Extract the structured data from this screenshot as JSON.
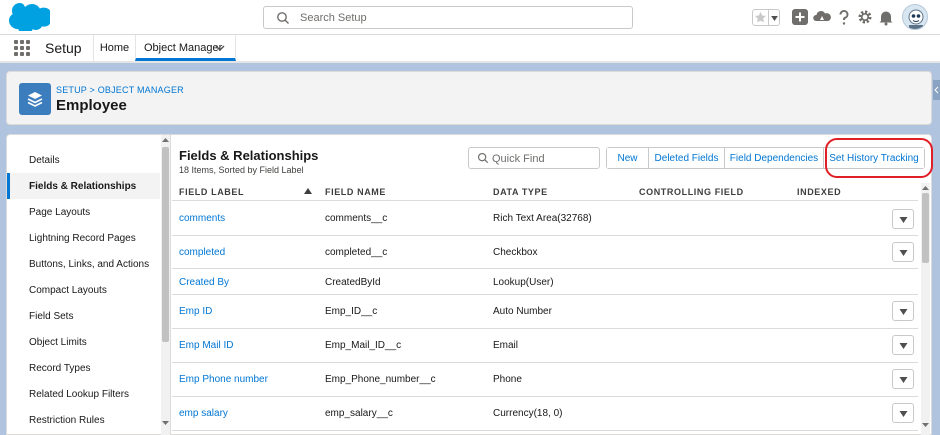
{
  "header": {
    "search_placeholder": "Search Setup"
  },
  "nav": {
    "app_name": "Setup",
    "tabs": [
      {
        "label": "Home"
      },
      {
        "label": "Object Manager"
      }
    ]
  },
  "object": {
    "breadcrumb": "SETUP > OBJECT MANAGER",
    "title": "Employee"
  },
  "sidebar": {
    "items": [
      {
        "label": "Details"
      },
      {
        "label": "Fields & Relationships"
      },
      {
        "label": "Page Layouts"
      },
      {
        "label": "Lightning Record Pages"
      },
      {
        "label": "Buttons, Links, and Actions"
      },
      {
        "label": "Compact Layouts"
      },
      {
        "label": "Field Sets"
      },
      {
        "label": "Object Limits"
      },
      {
        "label": "Record Types"
      },
      {
        "label": "Related Lookup Filters"
      },
      {
        "label": "Restriction Rules"
      }
    ]
  },
  "section": {
    "title": "Fields & Relationships",
    "subtitle": "18 Items, Sorted by Field Label",
    "quick_find_placeholder": "Quick Find",
    "buttons": [
      {
        "label": "New"
      },
      {
        "label": "Deleted Fields"
      },
      {
        "label": "Field Dependencies"
      },
      {
        "label": "Set History Tracking"
      }
    ]
  },
  "table": {
    "columns": [
      "FIELD LABEL",
      "FIELD NAME",
      "DATA TYPE",
      "CONTROLLING FIELD",
      "INDEXED"
    ],
    "rows": [
      {
        "label": "comments",
        "name": "comments__c",
        "type": "Rich Text Area(32768)",
        "controlling": "",
        "indexed": "",
        "has_menu": true
      },
      {
        "label": "completed",
        "name": "completed__c",
        "type": "Checkbox",
        "controlling": "",
        "indexed": "",
        "has_menu": true
      },
      {
        "label": "Created By",
        "name": "CreatedById",
        "type": "Lookup(User)",
        "controlling": "",
        "indexed": "",
        "has_menu": false
      },
      {
        "label": "Emp ID",
        "name": "Emp_ID__c",
        "type": "Auto Number",
        "controlling": "",
        "indexed": "",
        "has_menu": true
      },
      {
        "label": "Emp Mail ID",
        "name": "Emp_Mail_ID__c",
        "type": "Email",
        "controlling": "",
        "indexed": "",
        "has_menu": true
      },
      {
        "label": "Emp Phone number",
        "name": "Emp_Phone_number__c",
        "type": "Phone",
        "controlling": "",
        "indexed": "",
        "has_menu": true
      },
      {
        "label": "emp salary",
        "name": "emp_salary__c",
        "type": "Currency(18, 0)",
        "controlling": "",
        "indexed": "",
        "has_menu": true
      }
    ]
  },
  "colors": {
    "brand": "#0176d3",
    "highlight": "#e01e25",
    "object_icon": "#3c7ebd"
  },
  "icons": [
    "salesforce-cloud-logo",
    "search-icon",
    "favorites-star-icon",
    "add-icon",
    "trailhead-icon",
    "help-icon",
    "gear-icon",
    "bell-icon",
    "avatar",
    "app-launcher-icon",
    "layers-icon",
    "chevron-down-icon"
  ]
}
